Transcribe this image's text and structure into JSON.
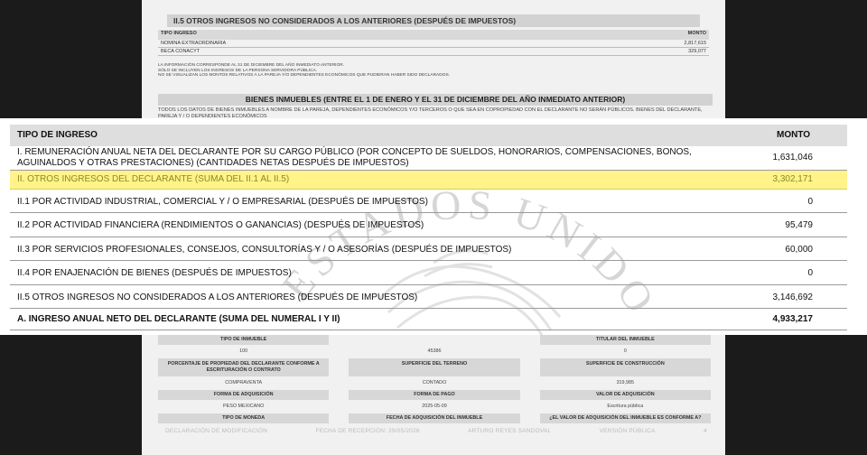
{
  "background_doc": {
    "section_title": "II.5 OTROS INGRESOS NO CONSIDERADOS A LOS ANTERIORES (DESPUÉS DE IMPUESTOS)",
    "table_header": {
      "left": "TIPO INGRESO",
      "right": "MONTO"
    },
    "table_rows": [
      {
        "label": "NOMINA EXTRAORDINARIA",
        "value": "2,817,615"
      },
      {
        "label": "BECA CONACYT",
        "value": "329,077"
      }
    ],
    "notes": [
      "LA INFORMACIÓN CORRESPONDE AL 31 DE DICIEMBRE DEL AÑO INMEDIATO ANTERIOR.",
      "SÓLO SE INCLUYEN LOS INGRESOS DE LA PERSONA SERVIDORA PÚBLICA.",
      "NO SE VISUALIZAN LOS MONTOS RELATIVOS A LA PAREJA Y/O DEPENDIENTES ECONÓMICOS QUE PUDIERAN HABER SIDO DECLARADOS."
    ],
    "band_title": "BIENES INMUEBLES (ENTRE EL 1 DE ENERO Y EL 31 DE DICIEMBRE DEL AÑO INMEDIATO ANTERIOR)",
    "paragraph": "TODOS LOS DATOS DE BIENES INMUEBLES A NOMBRE DE LA PAREJA, DEPENDIENTES ECONÓMICOS Y/O TERCEROS O QUE SEA EN COPROPIEDAD CON EL DECLARANTE NO SERÁN PÚBLICOS. BIENES DEL DECLARANTE, PAREJA Y / O DEPENDIENTES ECONÓMICOS",
    "grid": [
      {
        "value": "",
        "label": "TIPO DE INMUEBLE"
      },
      {
        "value": "",
        "label": ""
      },
      {
        "value": "",
        "label": "TITULAR DEL INMUEBLE"
      },
      {
        "value": "100",
        "label": "PORCENTAJE DE PROPIEDAD DEL DECLARANTE CONFORME A ESCRITURACIÓN O CONTRATO"
      },
      {
        "value": "45386",
        "label": "SUPERFICIE DEL TERRENO"
      },
      {
        "value": "0",
        "label": "SUPERFICIE DE CONSTRUCCIÓN"
      },
      {
        "value": "COMPRAVENTA",
        "label": "FORMA DE ADQUISICIÓN"
      },
      {
        "value": "CONTADO",
        "label": "FORMA DE PAGO"
      },
      {
        "value": "319,985",
        "label": "VALOR DE ADQUISICIÓN"
      },
      {
        "value": "PESO MEXICANO",
        "label": "TIPO DE MONEDA"
      },
      {
        "value": "2025-05-09",
        "label": "FECHA DE ADQUISICIÓN DEL INMUEBLE"
      },
      {
        "value": "Escritura pública",
        "label": "¿EL VALOR DE ADQUISICIÓN DEL INMUEBLE ES CONFORME A?"
      }
    ],
    "footer": {
      "left": "DECLARACIÓN DE MODIFICACIÓN",
      "date": "FECHA DE RECEPCIÓN: 29/05/2026",
      "name": "ARTURO REYES SANDOVAL",
      "version": "VERSIÓN PÚBLICA",
      "page": "4"
    }
  },
  "income_table": {
    "header": {
      "type": "TIPO DE INGRESO",
      "amount": "MONTO"
    },
    "rows": [
      {
        "label": "I. REMUNERACIÓN ANUAL NETA DEL DECLARANTE POR SU CARGO PÚBLICO (POR CONCEPTO DE SUELDOS, HONORARIOS, COMPENSACIONES, BONOS, AGUINALDOS Y OTRAS PRESTACIONES) (CANTIDADES NETAS DESPUÉS DE IMPUESTOS)",
        "value": "1,631,046"
      },
      {
        "label": "II. OTROS INGRESOS DEL DECLARANTE (SUMA DEL II.1 AL II.5)",
        "value": "3,302,171"
      },
      {
        "label": "II.1 POR ACTIVIDAD INDUSTRIAL, COMERCIAL Y / O EMPRESARIAL (DESPUÉS DE IMPUESTOS)",
        "value": "0"
      },
      {
        "label": "II.2 POR ACTIVIDAD FINANCIERA (RENDIMIENTOS O GANANCIAS) (DESPUÉS DE IMPUESTOS)",
        "value": "95,479"
      },
      {
        "label": "II.3 POR SERVICIOS PROFESIONALES, CONSEJOS, CONSULTORÍAS Y / O ASESORÍAS (DESPUÉS DE IMPUESTOS)",
        "value": "60,000"
      },
      {
        "label": "II.4 POR ENAJENACIÓN DE BIENES (DESPUÉS DE IMPUESTOS)",
        "value": "0"
      },
      {
        "label": "II.5 OTROS INGRESOS NO CONSIDERADOS A LOS ANTERIORES (DESPUÉS DE IMPUESTOS)",
        "value": "3,146,692"
      },
      {
        "label": "A. INGRESO ANUAL NETO DEL DECLARANTE (SUMA DEL NUMERAL I Y II)",
        "value": "4,933,217"
      }
    ]
  },
  "watermark": {
    "text": "ESTADOS UNIDOS MEXICANOS"
  },
  "colors": {
    "highlight": "#fff38a",
    "header_bg": "#dedede",
    "page_bg": "#f1f1f1",
    "surround": "#1b1b1b"
  }
}
